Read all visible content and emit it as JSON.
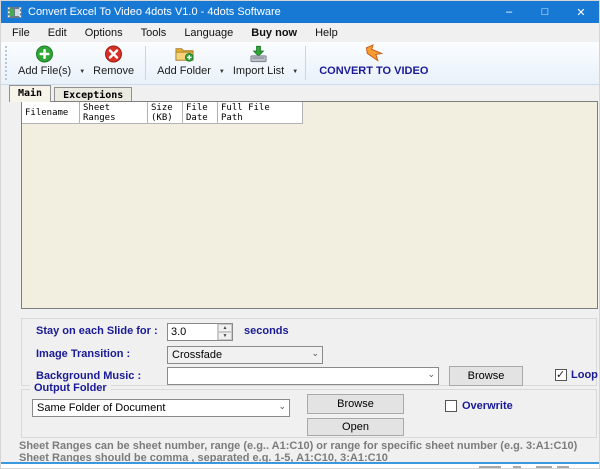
{
  "window": {
    "title": "Convert Excel To Video 4dots V1.0 - 4dots Software",
    "controls": {
      "minimize": "–",
      "maximize": "□",
      "close": "✕"
    }
  },
  "menu": {
    "items": [
      {
        "label": "File"
      },
      {
        "label": "Edit"
      },
      {
        "label": "Options"
      },
      {
        "label": "Tools"
      },
      {
        "label": "Language"
      },
      {
        "label": "Buy now"
      },
      {
        "label": "Help"
      }
    ]
  },
  "toolbar": {
    "add_files": "Add File(s)",
    "remove": "Remove",
    "add_folder": "Add Folder",
    "import_list": "Import List",
    "convert": "CONVERT TO VIDEO",
    "dropdown_glyph": "▼",
    "icons": {
      "add_files": "plus-circle",
      "remove": "x-circle",
      "add_folder": "folder-plus",
      "import_list": "import-box",
      "convert": "orange-arrow"
    }
  },
  "tabs": {
    "main": "Main",
    "exceptions": "Exceptions"
  },
  "table": {
    "columns": [
      "Filename",
      "Sheet\nRanges",
      "Size\n(KB)",
      "File\nDate",
      "Full File\nPath"
    ],
    "rows": []
  },
  "settings": {
    "slide_label": "Stay on each Slide for :",
    "slide_value": "3.0",
    "slide_unit": "seconds",
    "spin_up": "▲",
    "spin_down": "▼",
    "transition_label": "Image Transition :",
    "transition_value": "Crossfade",
    "music_label": "Background Music :",
    "music_value": "",
    "browse_label": "Browse",
    "loop_label": "Loop",
    "loop_checked": true,
    "combo_arrow": "⌄"
  },
  "output": {
    "legend": "Output Folder",
    "folder_value": "Same Folder of Document",
    "browse_label": "Browse",
    "open_label": "Open",
    "overwrite_label": "Overwrite",
    "overwrite_checked": false
  },
  "help": {
    "line1": "Sheet Ranges can be sheet number, range (e.g.. A1:C10) or range for specific sheet number (e.g. 3:A1:C10)",
    "line2": "Sheet Ranges should be comma , separated e.g. 1-5, A1:C10, 3:A1:C10"
  },
  "colors": {
    "titlebar": "#1779d4",
    "label_navy": "#1a1a96",
    "green": "#2fa838",
    "red": "#d93025",
    "orange": "#f79b2e",
    "folder_yellow": "#f7c64b",
    "list_bg": "#f2efe1",
    "bottom_border_blue": "#3a99de"
  }
}
